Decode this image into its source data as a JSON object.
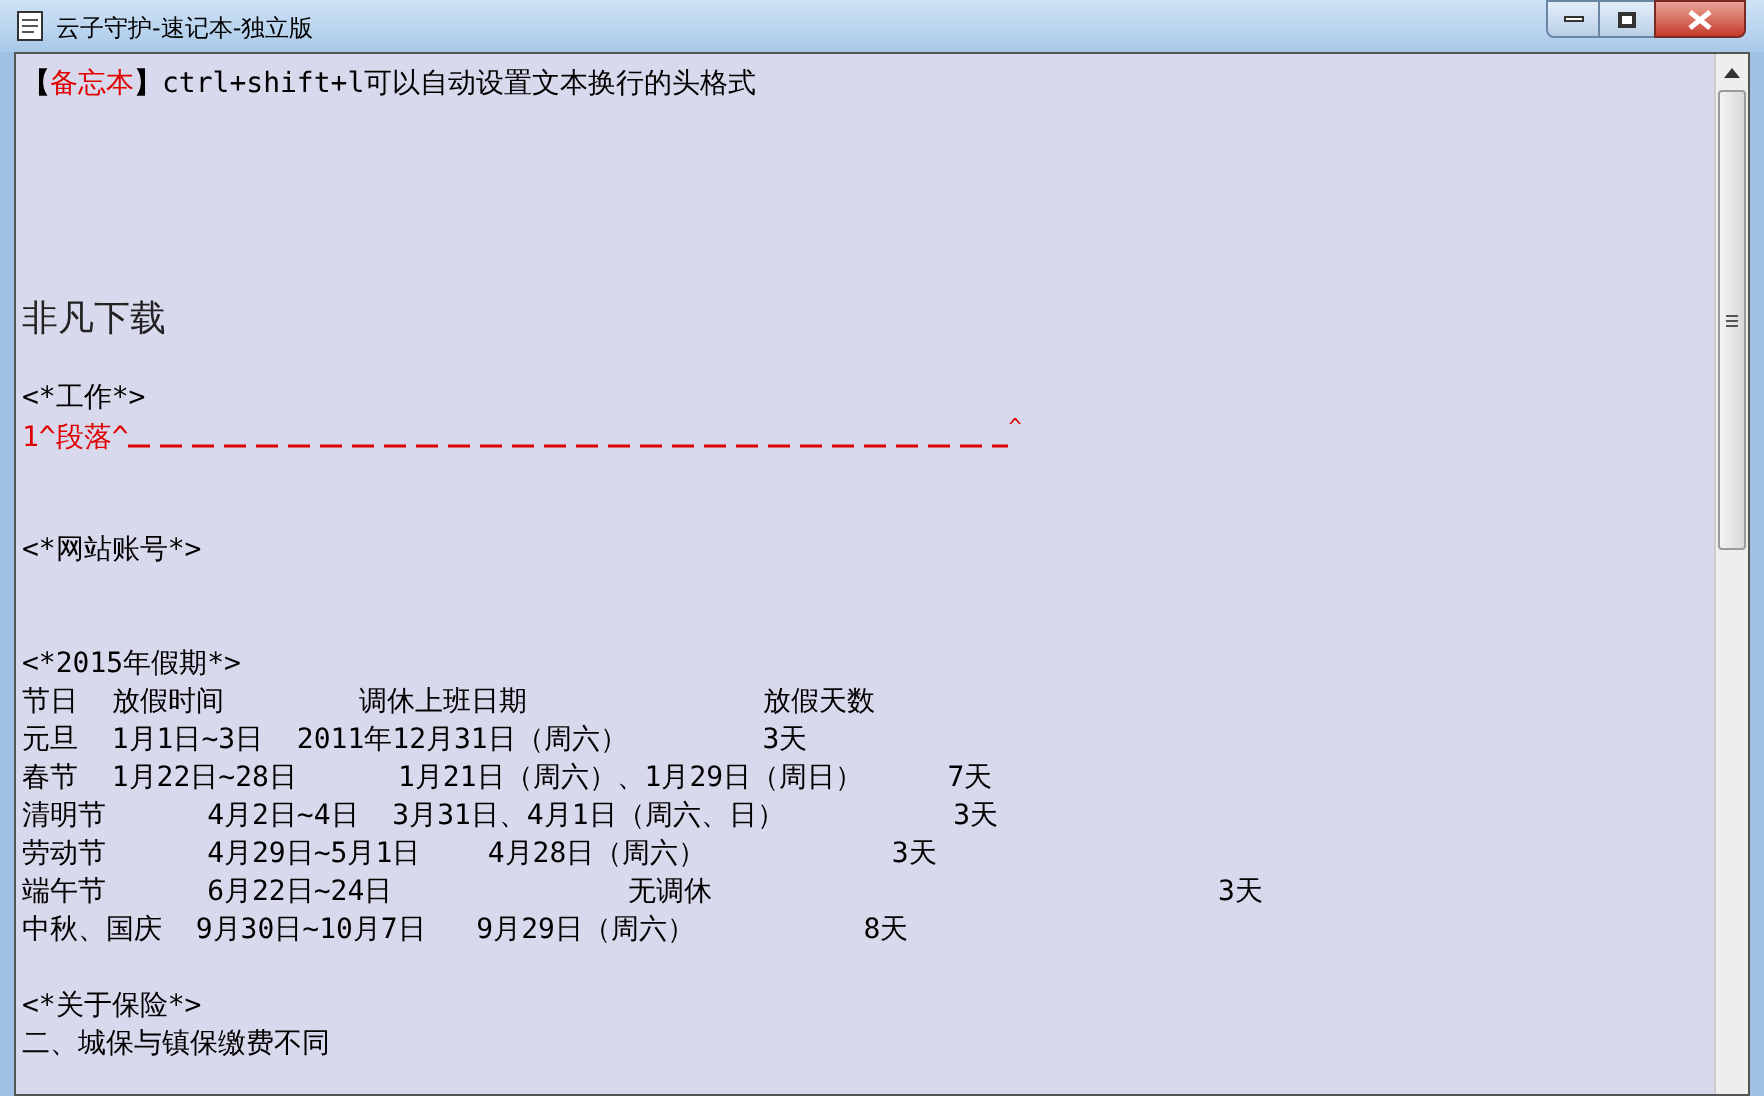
{
  "window": {
    "title": "云子守护-速记本-独立版"
  },
  "lines": [
    {
      "kind": "memo",
      "open": "【",
      "label": "备忘本",
      "close": "】",
      "text": "ctrl+shift+l可以自动设置文本换行的头格式"
    },
    {
      "kind": "blank"
    },
    {
      "kind": "blank"
    },
    {
      "kind": "blank"
    },
    {
      "kind": "blank"
    },
    {
      "kind": "blank"
    },
    {
      "kind": "heading",
      "text": "非凡下载"
    },
    {
      "kind": "blank"
    },
    {
      "kind": "text",
      "text": "<*工作*>"
    },
    {
      "kind": "paragraph-mark",
      "text": "1^段落^",
      "end": "^"
    },
    {
      "kind": "blank"
    },
    {
      "kind": "blank"
    },
    {
      "kind": "text",
      "text": "<*网站账号*>"
    },
    {
      "kind": "blank"
    },
    {
      "kind": "blank"
    },
    {
      "kind": "text",
      "text": "<*2015年假期*>"
    },
    {
      "kind": "text",
      "text": "节日  放假时间        调休上班日期              放假天数"
    },
    {
      "kind": "text",
      "text": "元旦  1月1日~3日  2011年12月31日（周六）        3天"
    },
    {
      "kind": "text",
      "text": "春节  1月22日~28日      1月21日（周六）、1月29日（周日）     7天"
    },
    {
      "kind": "text",
      "text": "清明节      4月2日~4日  3月31日、4月1日（周六、日）          3天"
    },
    {
      "kind": "text",
      "text": "劳动节      4月29日~5月1日    4月28日（周六）           3天"
    },
    {
      "kind": "text",
      "text": "端午节      6月22日~24日              无调休                              3天"
    },
    {
      "kind": "text",
      "text": "中秋、国庆  9月30日~10月7日   9月29日（周六）          8天"
    },
    {
      "kind": "blank"
    },
    {
      "kind": "text",
      "text": "<*关于保险*>"
    },
    {
      "kind": "text",
      "text": "二、城保与镇保缴费不同"
    }
  ]
}
